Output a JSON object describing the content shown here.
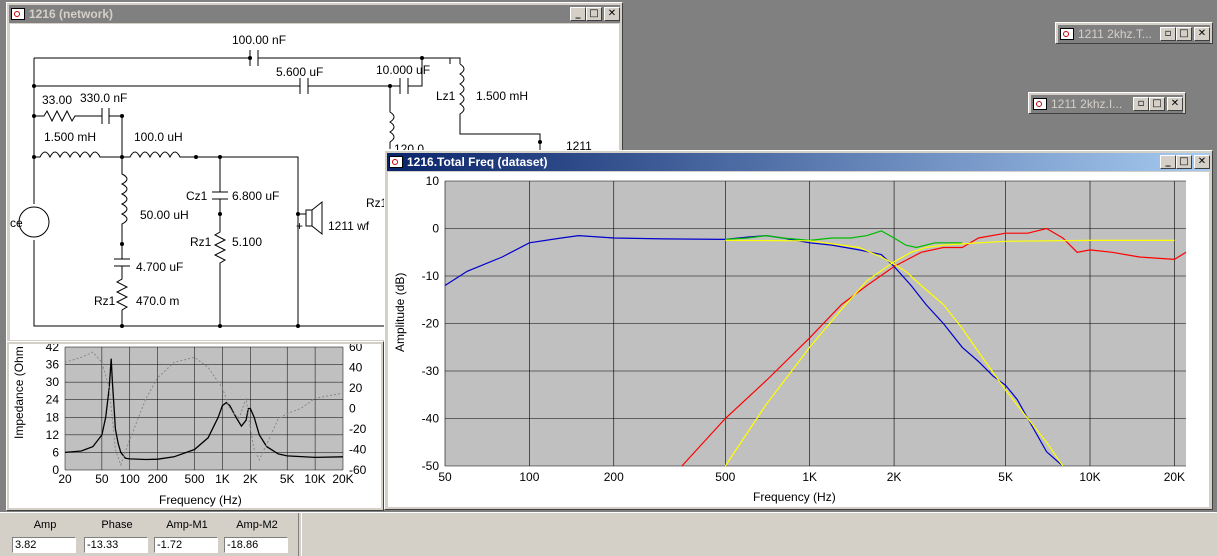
{
  "network_window": {
    "title": "1216 (network)",
    "components": {
      "c_top": "100.00 nF",
      "c_mid": "5.600 uF",
      "c_right": "10.000 uF",
      "lz1_ref": "Lz1",
      "lz1_val": "1.500 mH",
      "r_33": "33.00",
      "c_330": "330.0 nF",
      "l_1500": "1.500 mH",
      "l_100": "100.0 uH",
      "l_50": "50.00 uH",
      "c_4700": "4.700 uF",
      "rz1_ref": "Rz1",
      "rz1_val": "470.0 m",
      "cz1_ref": "Cz1",
      "cz1_val": "6.800 uF",
      "rz1b_ref": "Rz1",
      "rz1b_val": "5.100",
      "driver_sign": "+",
      "driver_label": "1211 wf",
      "source_label": "ce",
      "cut_l_label": "120.0",
      "cut_rz_label": "Rz1",
      "cut_tw_label": "1211"
    }
  },
  "impedance_window": {
    "ylabel": "Impedance (Ohm",
    "xlabel": "Frequency (Hz)",
    "left_ticks": [
      "42",
      "36",
      "30",
      "24",
      "18",
      "12",
      "6",
      "0"
    ],
    "right_ticks": [
      "60",
      "40",
      "20",
      "0",
      "-20",
      "-40",
      "-60"
    ],
    "x_ticks": [
      "20",
      "50",
      "100",
      "200",
      "500",
      "1K",
      "2K",
      "5K",
      "10K",
      "20K"
    ]
  },
  "min_window_1": {
    "title": "1211 2khz.T..."
  },
  "min_window_2": {
    "title": "1211 2khz.I..."
  },
  "freq_window": {
    "title": "1216.Total Freq (dataset)"
  },
  "status": {
    "fields": [
      {
        "label": "Amp",
        "value": "3.82"
      },
      {
        "label": "Phase",
        "value": "-13.33"
      },
      {
        "label": "Amp-M1",
        "value": "-1.72"
      },
      {
        "label": "Amp-M2",
        "value": "-18.86"
      }
    ]
  },
  "chart_data": [
    {
      "type": "line",
      "title": "",
      "xlabel": "Frequency (Hz)",
      "ylabel": "Amplitude (dB)",
      "xscale": "log",
      "xlim": [
        50,
        22000
      ],
      "ylim": [
        -50,
        10
      ],
      "x_ticks": [
        50,
        100,
        200,
        500,
        1000,
        2000,
        5000,
        10000,
        20000
      ],
      "x_tick_labels": [
        "50",
        "100",
        "200",
        "500",
        "1K",
        "2K",
        "5K",
        "10K",
        "20K"
      ],
      "y_ticks": [
        10,
        0,
        -10,
        -20,
        -30,
        -40,
        -50
      ],
      "grid": true,
      "background": "#c0c0c0",
      "series": [
        {
          "color": "#0000cc",
          "x": [
            50,
            60,
            80,
            100,
            130,
            150,
            200,
            300,
            500,
            600,
            700,
            800,
            1000,
            1200,
            1500,
            1800,
            2000,
            2300,
            2600,
            3000,
            3500,
            4000,
            4500,
            5000,
            5500,
            6000,
            7000,
            8000
          ],
          "y": [
            -12,
            -9,
            -6,
            -3,
            -2,
            -1.5,
            -2,
            -2.2,
            -2.3,
            -1.8,
            -1.5,
            -2,
            -3,
            -3.5,
            -4.5,
            -5.5,
            -8,
            -12,
            -16,
            -20,
            -25,
            -28,
            -31,
            -33,
            -36,
            -40,
            -47,
            -50
          ]
        },
        {
          "color": "#ff0000",
          "x": [
            350,
            500,
            700,
            1000,
            1300,
            1600,
            2000,
            2500,
            3000,
            3500,
            4000,
            5000,
            6000,
            7000,
            8000,
            9000,
            10000,
            12000,
            15000,
            20000,
            22000
          ],
          "y": [
            -50,
            -40,
            -32,
            -23,
            -16,
            -12,
            -8,
            -5,
            -4,
            -4,
            -2,
            -1,
            -1,
            0,
            -2,
            -5,
            -4.5,
            -5,
            -6,
            -6.5,
            -5
          ]
        },
        {
          "color": "#00bb00",
          "x": [
            500,
            600,
            700,
            800,
            1000,
            1200,
            1400,
            1600,
            1800,
            2000,
            2200,
            2400,
            2800,
            3500
          ],
          "y": [
            -2.3,
            -2,
            -1.5,
            -2,
            -2.5,
            -2,
            -2,
            -1.5,
            -0.5,
            -2,
            -3.5,
            -4,
            -3,
            -3
          ]
        },
        {
          "color": "#ffff00",
          "x": [
            500,
            1000,
            1500,
            1800,
            2000,
            2200,
            2500,
            3000,
            3500,
            4000,
            5000,
            6000,
            7000,
            8000
          ],
          "y": [
            -2.5,
            -2.6,
            -4,
            -6,
            -7.5,
            -9,
            -12,
            -16,
            -21,
            -26,
            -34,
            -40,
            -45,
            -50
          ]
        },
        {
          "color": "#ffff00",
          "x": [
            500,
            700,
            1000,
            1300,
            1600,
            2000,
            2300,
            2600,
            3000,
            4000,
            5000,
            7000,
            10000,
            15000,
            20000
          ],
          "y": [
            -50,
            -37,
            -25,
            -17,
            -11,
            -7,
            -5,
            -4,
            -3.5,
            -3,
            -2.7,
            -2.6,
            -2.5,
            -2.5,
            -2.5
          ]
        }
      ]
    },
    {
      "type": "line",
      "title": "",
      "xlabel": "Frequency (Hz)",
      "ylabel": "Impedance (Ohm",
      "xscale": "log",
      "xlim": [
        20,
        20000
      ],
      "ylim": [
        0,
        42
      ],
      "y2lim": [
        -60,
        60
      ],
      "grid": true,
      "background": "#c0c0c0",
      "series": [
        {
          "color": "#000000",
          "axis": "left",
          "x": [
            20,
            30,
            40,
            50,
            55,
            60,
            63,
            65,
            68,
            70,
            75,
            80,
            90,
            100,
            150,
            200,
            300,
            500,
            700,
            900,
            1000,
            1100,
            1200,
            1400,
            1600,
            1800,
            1900,
            2000,
            2200,
            2500,
            3000,
            4000,
            5000,
            10000,
            20000
          ],
          "y": [
            6,
            6.5,
            8,
            12,
            18,
            28,
            38,
            30,
            20,
            14,
            9,
            6,
            4,
            3.8,
            3.6,
            3.7,
            4.5,
            7,
            11,
            18,
            22,
            23,
            22,
            18,
            15,
            17,
            21,
            21,
            18,
            12,
            8,
            5.5,
            4.8,
            4.3,
            4.5
          ]
        },
        {
          "color": "#888888",
          "axis": "right",
          "x": [
            20,
            30,
            40,
            50,
            60,
            65,
            70,
            80,
            100,
            150,
            200,
            300,
            500,
            700,
            1000,
            1200,
            1500,
            1800,
            2000,
            2200,
            2500,
            3000,
            4000,
            5000,
            7000,
            10000,
            20000
          ],
          "y": [
            45,
            50,
            55,
            45,
            20,
            -10,
            -40,
            -55,
            -30,
            10,
            30,
            45,
            50,
            40,
            20,
            0,
            -10,
            10,
            -20,
            -40,
            -50,
            -35,
            -10,
            -5,
            0,
            10,
            15
          ]
        }
      ]
    }
  ]
}
